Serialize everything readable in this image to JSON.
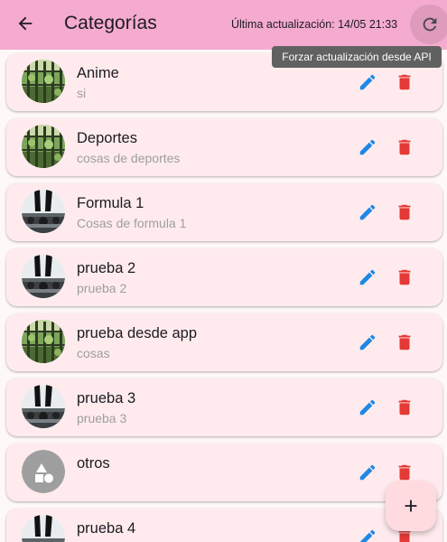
{
  "appbar": {
    "title": "Categorías",
    "last_updated": "Última actualización: 14/05 21:33",
    "back_icon": "arrow-back-icon",
    "refresh_icon": "refresh-icon",
    "background": "#f4abcf"
  },
  "tooltip": {
    "text": "Forzar actualización desde API"
  },
  "categories": [
    {
      "name": "Anime",
      "description": "si",
      "image": "forest-image"
    },
    {
      "name": "Deportes",
      "description": "cosas de deportes",
      "image": "forest-image"
    },
    {
      "name": "Formula 1",
      "description": "Cosas de formula 1",
      "image": "car-image"
    },
    {
      "name": "prueba 2",
      "description": "prueba 2",
      "image": "car-image"
    },
    {
      "name": "prueba desde app",
      "description": "cosas",
      "image": "forest-image"
    },
    {
      "name": "prueba 3",
      "description": "prueba 3",
      "image": "car-image"
    },
    {
      "name": "otros",
      "description": "",
      "image": "category-shapes-icon"
    },
    {
      "name": "prueba 4",
      "description": "",
      "image": "car-image"
    }
  ],
  "colors": {
    "card": "#ffebee",
    "edit": "#1e88e5",
    "delete": "#e53935",
    "fab": "#ffdbe0"
  },
  "fab": {
    "icon": "add-icon"
  }
}
